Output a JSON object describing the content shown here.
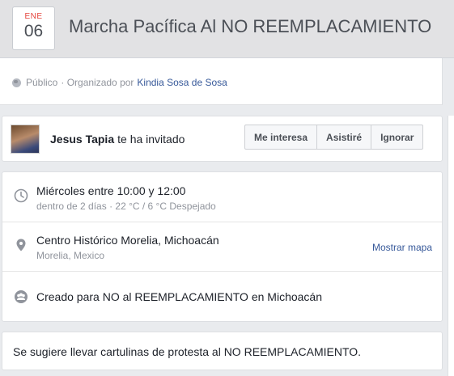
{
  "event": {
    "month": "ENE",
    "day": "06",
    "title": "Marcha Pacífica Al NO REEMPLACAMIENTO"
  },
  "host": {
    "privacy": "Público",
    "organized_by": "· Organizado por",
    "organizer": "Kindia Sosa de Sosa"
  },
  "invite": {
    "inviter": "Jesus Tapia",
    "invite_text": "te ha invitado",
    "buttons": [
      "Me interesa",
      "Asistiré",
      "Ignorar"
    ]
  },
  "details": {
    "time": "Miércoles entre 10:00 y 12:00",
    "weather": "dentro de 2 días · 22 °C / 6 °C Despejado",
    "location": "Centro Histórico Morelia, Michoacán",
    "city": "Morelia, Mexico",
    "map_link": "Mostrar mapa",
    "created_for": "Creado para NO al REEMPLACAMIENTO en Michoacán"
  },
  "description": "Se sugiere llevar cartulinas de protesta al NO REEMPLACAMIENTO.",
  "icons": {
    "clock": "clock-icon",
    "pin": "map-pin-icon",
    "group": "group-icon",
    "globe": "globe-icon"
  },
  "colors": {
    "link": "#365899",
    "month": "#e4433b",
    "muted": "#90949c"
  }
}
